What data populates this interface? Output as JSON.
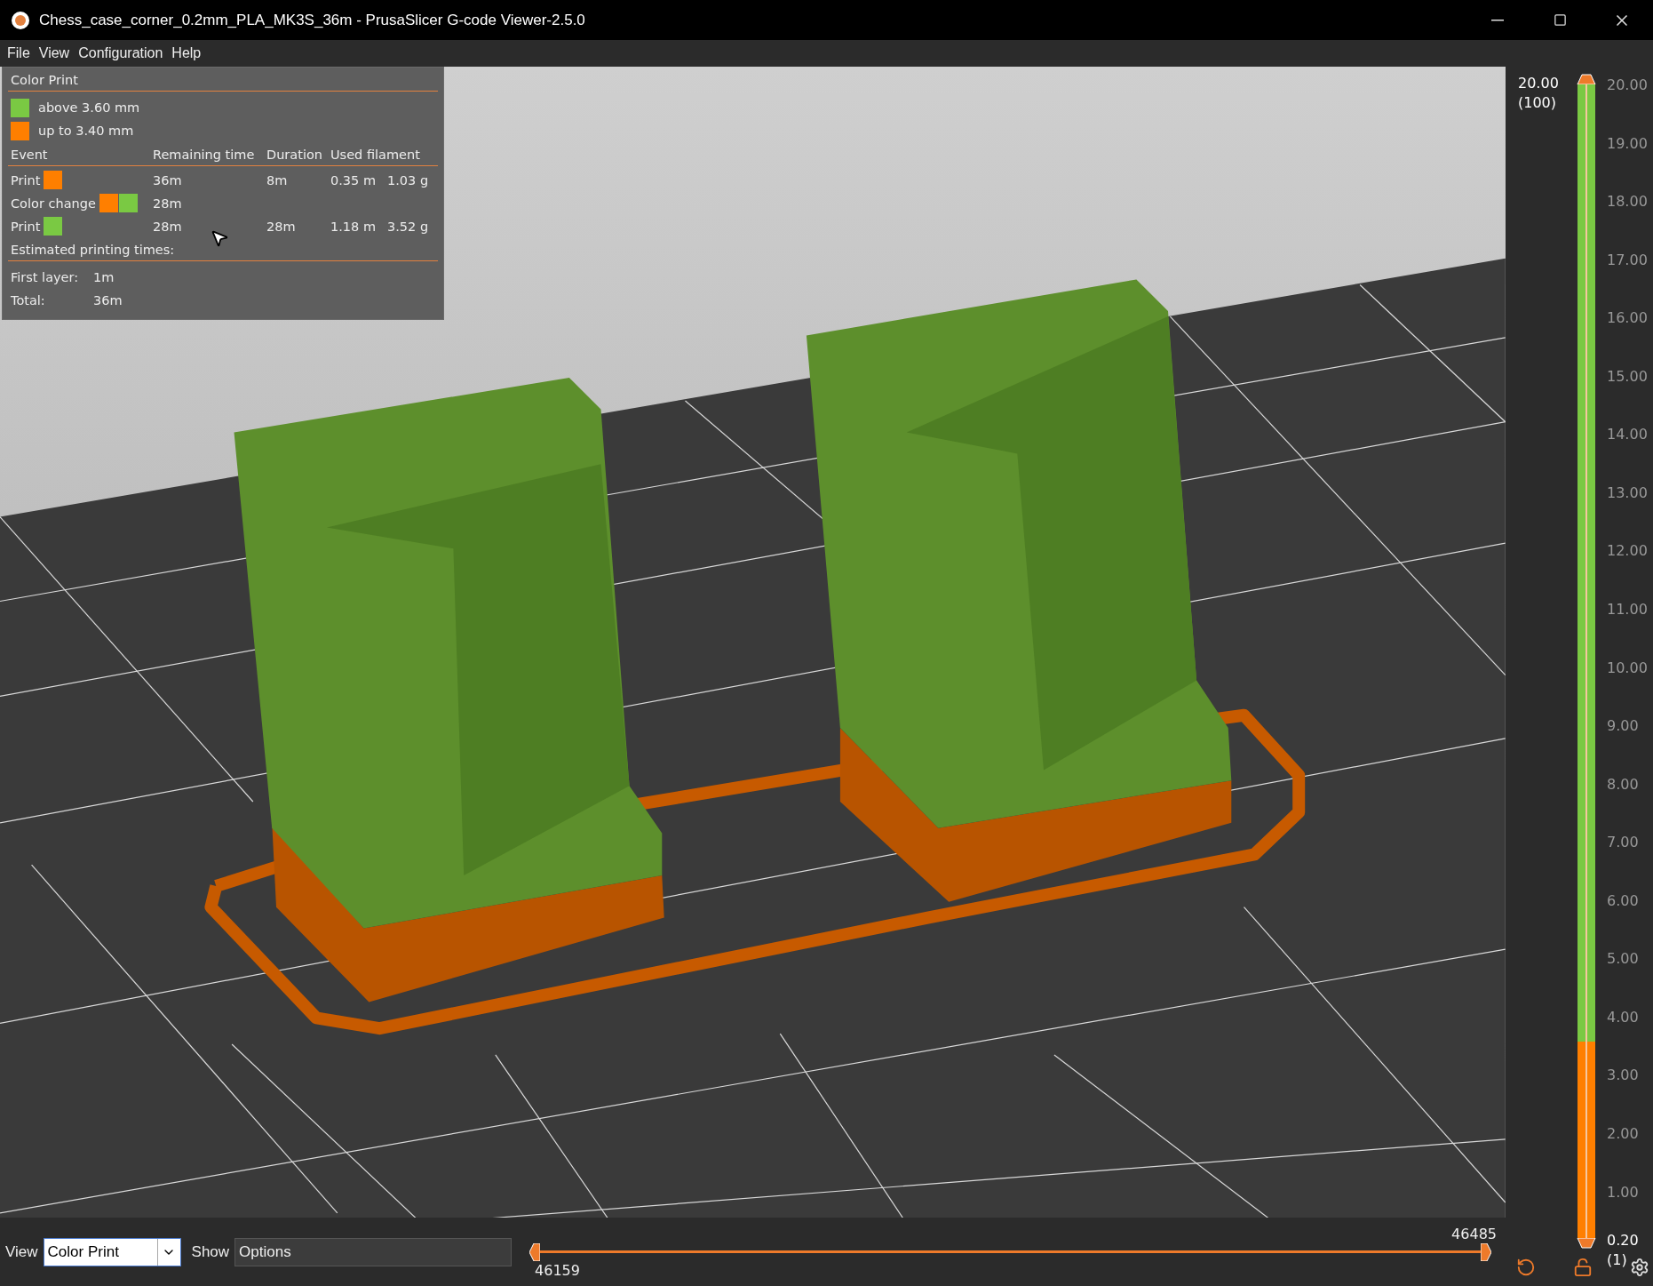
{
  "window": {
    "title": "Chess_case_corner_0.2mm_PLA_MK3S_36m - PrusaSlicer G-code Viewer-2.5.0"
  },
  "menu": [
    "File",
    "View",
    "Configuration",
    "Help"
  ],
  "legend": {
    "title": "Color Print",
    "items": [
      {
        "color": "#7ac943",
        "label": "above 3.60 mm"
      },
      {
        "color": "#ff7f00",
        "label": "up to 3.40 mm"
      }
    ],
    "columns": [
      "Event",
      "Remaining time",
      "Duration",
      "Used filament"
    ],
    "events": [
      {
        "name": "Print",
        "swatches": [
          {
            "color": "#ff7f00"
          }
        ],
        "remaining": "36m",
        "duration": "8m",
        "length": "0.35 m",
        "weight": "1.03 g"
      },
      {
        "name": "Color change",
        "swatches": [
          {
            "color": "#ff7f00"
          },
          {
            "color": "#7ac943"
          }
        ],
        "remaining": "28m"
      },
      {
        "name": "Print",
        "swatches": [
          {
            "color": "#7ac943"
          }
        ],
        "remaining": "28m",
        "duration": "28m",
        "length": "1.18 m",
        "weight": "3.52 g"
      }
    ],
    "times_title": "Estimated printing times:",
    "times": [
      {
        "label": "First layer:",
        "value": "1m"
      },
      {
        "label": "Total:",
        "value": "36m"
      }
    ]
  },
  "bottom_bar": {
    "view_label": "View",
    "view_value": "Color Print",
    "show_label": "Show",
    "show_value": "Options"
  },
  "horizontal_slider": {
    "upper_value": "46485",
    "lower_value": "46159"
  },
  "vertical_slider": {
    "upper_value": "20.00",
    "upper_layer": "(100)",
    "lower_value": "0.20",
    "lower_layer": "(1)",
    "bands": [
      {
        "color": "#ff7f00",
        "level": 0.17
      },
      {
        "color": "#7ac943",
        "level": 0.83
      }
    ],
    "scale": [
      "20.00",
      "19.00",
      "18.00",
      "17.00",
      "16.00",
      "15.00",
      "14.00",
      "13.00",
      "12.00",
      "11.00",
      "10.00",
      "9.00",
      "8.00",
      "7.00",
      "6.00",
      "5.00",
      "4.00",
      "3.00",
      "2.00",
      "1.00"
    ]
  }
}
